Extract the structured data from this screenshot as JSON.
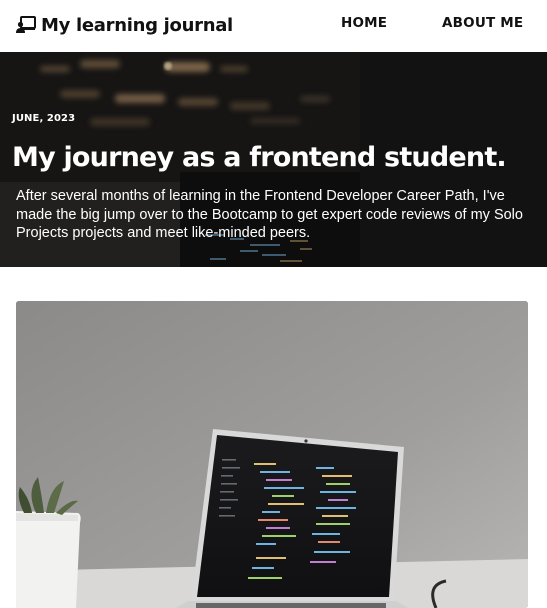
{
  "header": {
    "brand_title": "My learning journal",
    "brand_icon": "laptop-user-icon",
    "nav": [
      {
        "label": "HOME"
      },
      {
        "label": "ABOUT ME"
      }
    ]
  },
  "hero": {
    "date": "JUNE, 2023",
    "title": "My journey as a frontend student.",
    "text": "After several months of learning in the Frontend Developer Career Path, I've made the big jump over to the Bootcamp to get expert code reviews of my Solo Projects projects and meet like-minded peers."
  },
  "featured_image": {
    "subject": "laptop with code editor next to a potted succulent"
  }
}
